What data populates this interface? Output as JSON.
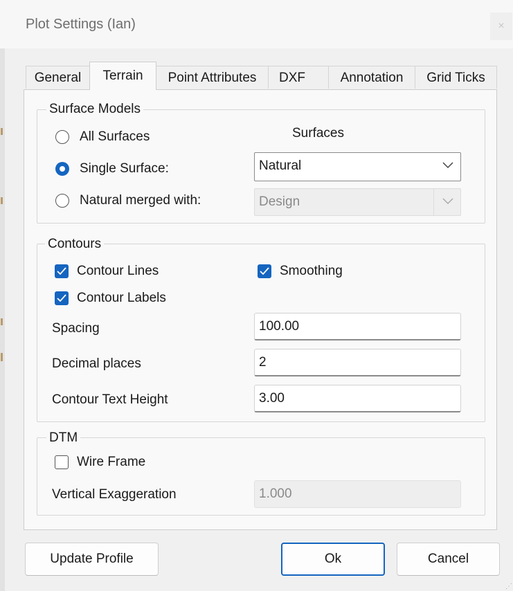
{
  "window": {
    "title": "Plot Settings  (Ian)",
    "close_label": "×"
  },
  "tabs": [
    {
      "label": "General",
      "active": false
    },
    {
      "label": "Terrain",
      "active": true
    },
    {
      "label": "Point Attributes",
      "active": false
    },
    {
      "label": "DXF",
      "active": false
    },
    {
      "label": "Annotation",
      "active": false
    },
    {
      "label": "Grid Ticks",
      "active": false
    }
  ],
  "surface_models": {
    "legend": "Surface Models",
    "surfaces_header": "Surfaces",
    "options": [
      {
        "label": "All Surfaces",
        "checked": false
      },
      {
        "label": "Single Surface:",
        "checked": true
      },
      {
        "label": "Natural merged with:",
        "checked": false
      }
    ],
    "single_surface_value": "Natural",
    "merged_with_value": "Design"
  },
  "contours": {
    "legend": "Contours",
    "contour_lines": {
      "label": "Contour Lines",
      "checked": true
    },
    "smoothing": {
      "label": "Smoothing",
      "checked": true
    },
    "contour_labels": {
      "label": "Contour Labels",
      "checked": true
    },
    "spacing": {
      "label": "Spacing",
      "value": "100.00"
    },
    "decimal_places": {
      "label": "Decimal places",
      "value": "2"
    },
    "text_height": {
      "label": "Contour Text Height",
      "value": "3.00"
    }
  },
  "dtm": {
    "legend": "DTM",
    "wire_frame": {
      "label": "Wire Frame",
      "checked": false
    },
    "vertical_exaggeration": {
      "label": "Vertical Exaggeration",
      "value": "1.000"
    }
  },
  "buttons": {
    "update_profile": "Update Profile",
    "ok": "Ok",
    "cancel": "Cancel"
  },
  "colors": {
    "accent": "#1565c0",
    "background": "#f0f0f0",
    "panel": "#f9f9f9"
  }
}
